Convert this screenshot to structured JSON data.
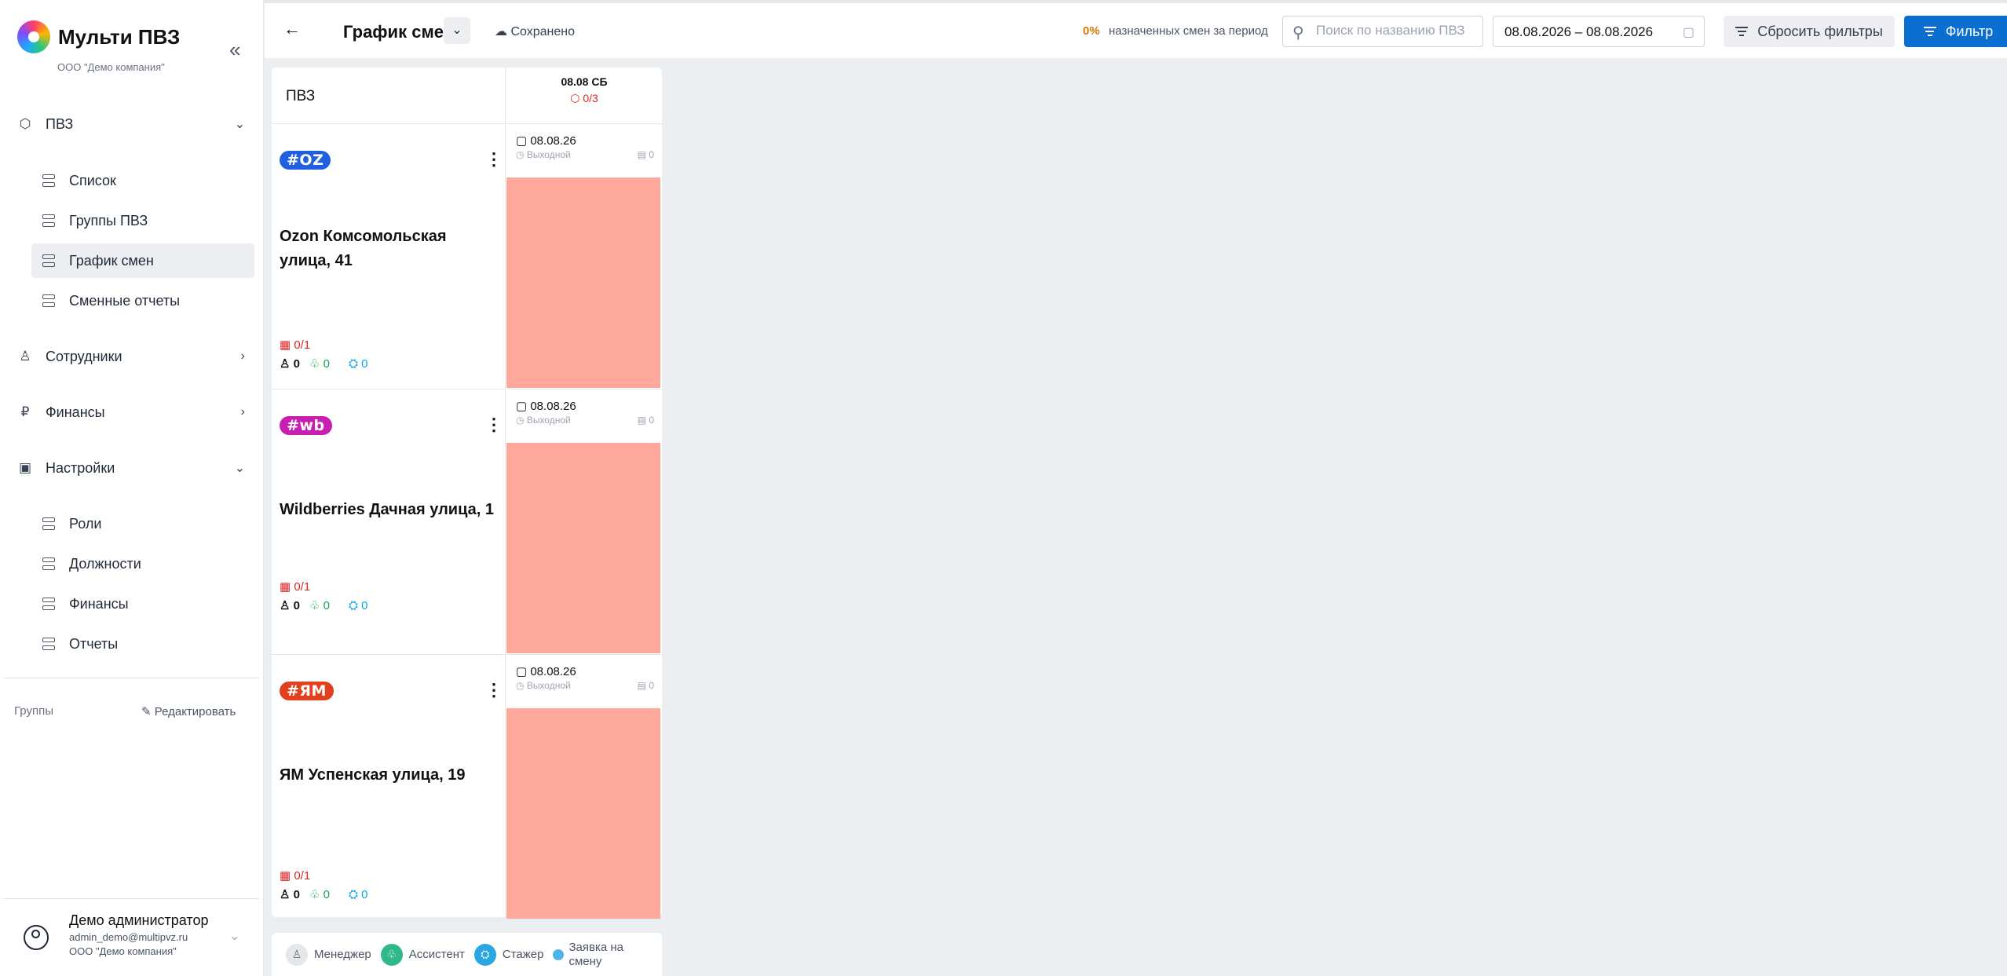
{
  "app": {
    "title": "Мульти ПВЗ",
    "company": "ООО \"Демо компания\""
  },
  "sidebar": {
    "groups": [
      {
        "label": "ПВЗ",
        "icon": "box-icon",
        "expanded": true
      },
      {
        "label": "Сотрудники",
        "icon": "user-icon",
        "expanded": false
      },
      {
        "label": "Финансы",
        "icon": "ruble-icon",
        "expanded": false
      },
      {
        "label": "Настройки",
        "icon": "clipboard-icon",
        "expanded": true
      }
    ],
    "pvz_items": [
      {
        "label": "Список"
      },
      {
        "label": "Группы ПВЗ"
      },
      {
        "label": "График смен",
        "active": true
      },
      {
        "label": "Сменные отчеты"
      }
    ],
    "settings_items": [
      {
        "label": "Роли"
      },
      {
        "label": "Должности"
      },
      {
        "label": "Финансы"
      },
      {
        "label": "Отчеты"
      }
    ],
    "groups_label": "Группы",
    "edit_label": "Редактировать"
  },
  "user": {
    "name": "Демо администратор",
    "email": "admin_demo@multipvz.ru",
    "company": "ООО \"Демо компания\""
  },
  "header": {
    "title": "График смен",
    "saved": "Сохранено",
    "percent": "0%",
    "percent_text": "назначенных смен за период",
    "search_placeholder": "Поиск по названию ПВЗ",
    "date_range": "08.08.2026 – 08.08.2026",
    "reset_label": "Сбросить фильтры",
    "filter_label": "Фильтр"
  },
  "grid": {
    "column_header": "ПВЗ",
    "day": {
      "label": "08.08 СБ",
      "count": "0/3"
    },
    "rows": [
      {
        "badge": "#OZ",
        "badge_color": "#1f5fe0",
        "name": "Ozon Комсомольская улица, 41",
        "cal_stat": "0/1",
        "managers": "0",
        "assistants": "0",
        "trainees": "0",
        "cell": {
          "date": "08.08.26",
          "status": "Выходной",
          "count": "0"
        }
      },
      {
        "badge": "#wb",
        "badge_color": "#c81fb3",
        "name": "Wildberries Дачная улица, 1",
        "cal_stat": "0/1",
        "managers": "0",
        "assistants": "0",
        "trainees": "0",
        "cell": {
          "date": "08.08.26",
          "status": "Выходной",
          "count": "0"
        }
      },
      {
        "badge": "#ЯM",
        "badge_color": "#e2401c",
        "name": "ЯМ Успенская улица, 19",
        "cal_stat": "0/1",
        "managers": "0",
        "assistants": "0",
        "trainees": "0",
        "cell": {
          "date": "08.08.26",
          "status": "Выходной",
          "count": "0"
        }
      }
    ],
    "shift_color": "#fda89a"
  },
  "legend": {
    "manager": "Менеджер",
    "assistant": "Ассистент",
    "trainee": "Стажер",
    "request": "Заявка на смену"
  }
}
